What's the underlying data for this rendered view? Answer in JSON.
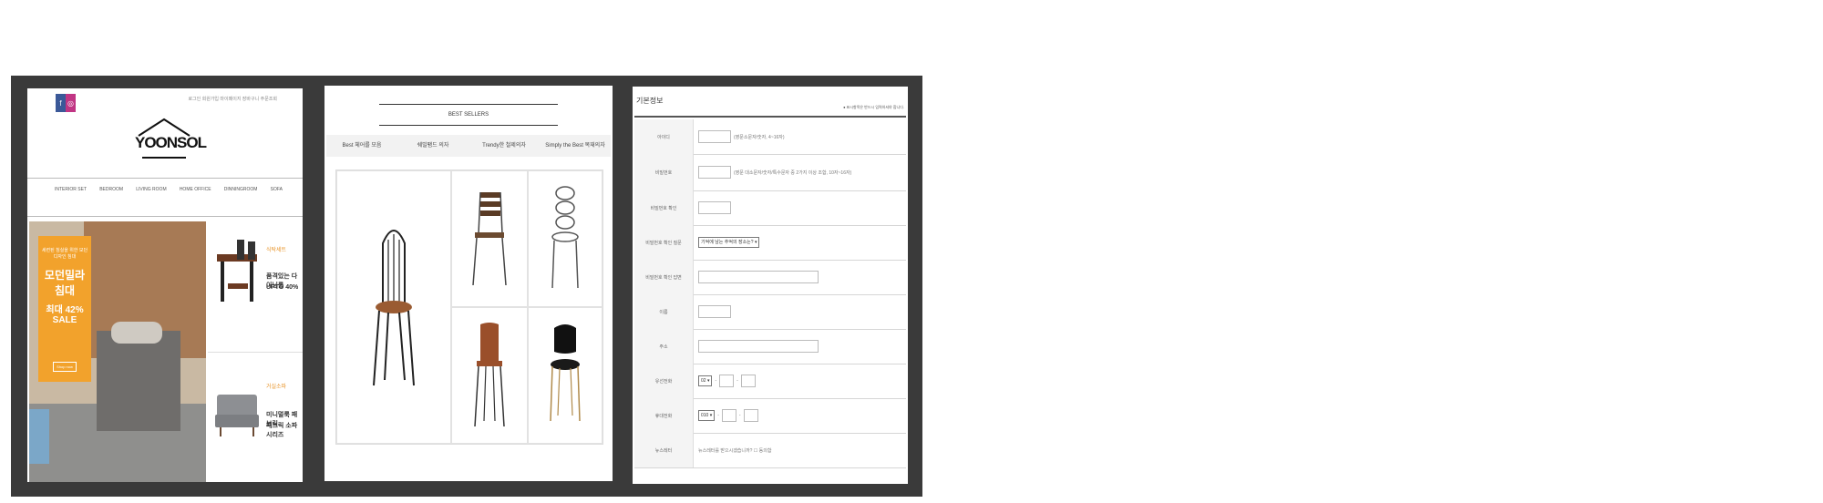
{
  "panel1": {
    "top_note": "로그인 회원가입 마이페이지 장바구니 주문조회",
    "logo": "YOONSOL",
    "nav": [
      "INTERIOR SET",
      "BEDROOM",
      "LIVING ROOM",
      "HOME OFFICE",
      "DINNINGROOM",
      "SOFA"
    ],
    "hero": {
      "subtitle": "세련된 침실을 위한 모던 디자인 침대",
      "title": "모던밀라 침대",
      "sale": "최대 42% SALE",
      "button": "Shop now"
    },
    "side1": {
      "tag": "식탁세트",
      "title1": "품격있는 다이닝룸",
      "title2": "UPTO 40%"
    },
    "side2": {
      "tag": "거실소파",
      "title1": "미니멀룩 패브릭",
      "title2": "패브릭 소파시리즈"
    },
    "colors": {
      "accent": "#f2a22c",
      "facebook": "#3b5998",
      "instagram": "#c13584"
    }
  },
  "panel2": {
    "heading": "BEST SELLERS",
    "tabs": [
      "Best 체어를 모음",
      "쉐빌팸드 의자",
      "Trendy한 철제의자",
      "Simply the Best 목재의자"
    ]
  },
  "panel3": {
    "section_title": "기본정보",
    "required_note": "● 표시항목은 반드시 입력하셔야 합니다.",
    "rows": [
      {
        "label": "아이디",
        "hint": "(영문소문자/숫자, 4~16자)"
      },
      {
        "label": "비밀번호",
        "hint": "(영문 대소문자/숫자/특수문자 중 2가지 이상 조합, 10자~16자)"
      },
      {
        "label": "비밀번호 확인",
        "hint": ""
      },
      {
        "label": "비밀번호 확인 질문",
        "select": "기억에 남는 추억의 장소는?"
      },
      {
        "label": "비밀번호 확인 답변",
        "hint": ""
      },
      {
        "label": "이름",
        "hint": ""
      },
      {
        "label": "주소",
        "hint": ""
      },
      {
        "label": "유선전화",
        "select": "02",
        "sep": "-"
      },
      {
        "label": "휴대전화",
        "select": "010",
        "sep": "-"
      },
      {
        "label": "뉴스레터",
        "hint": "뉴스레터를 받으시겠습니까? ☐ 동의함"
      }
    ]
  }
}
